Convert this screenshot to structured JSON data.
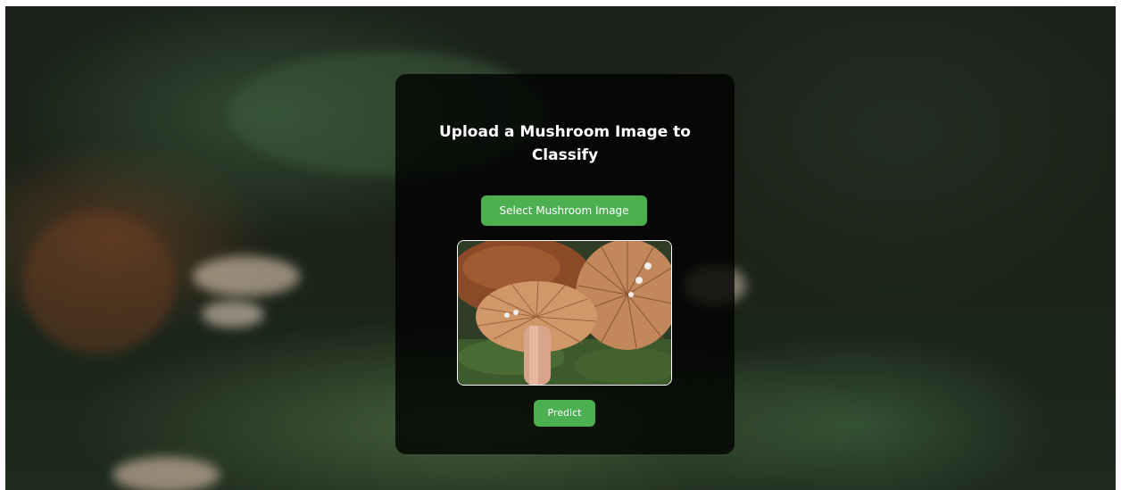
{
  "card": {
    "title": "Upload a Mushroom Image to Classify",
    "select_button_label": "Select Mushroom Image",
    "predict_button_label": "Predict"
  },
  "preview": {
    "image_subject": "mushroom-photo"
  },
  "colors": {
    "accent": "#4caf50",
    "card_background": "#000000",
    "text": "#ffffff"
  }
}
